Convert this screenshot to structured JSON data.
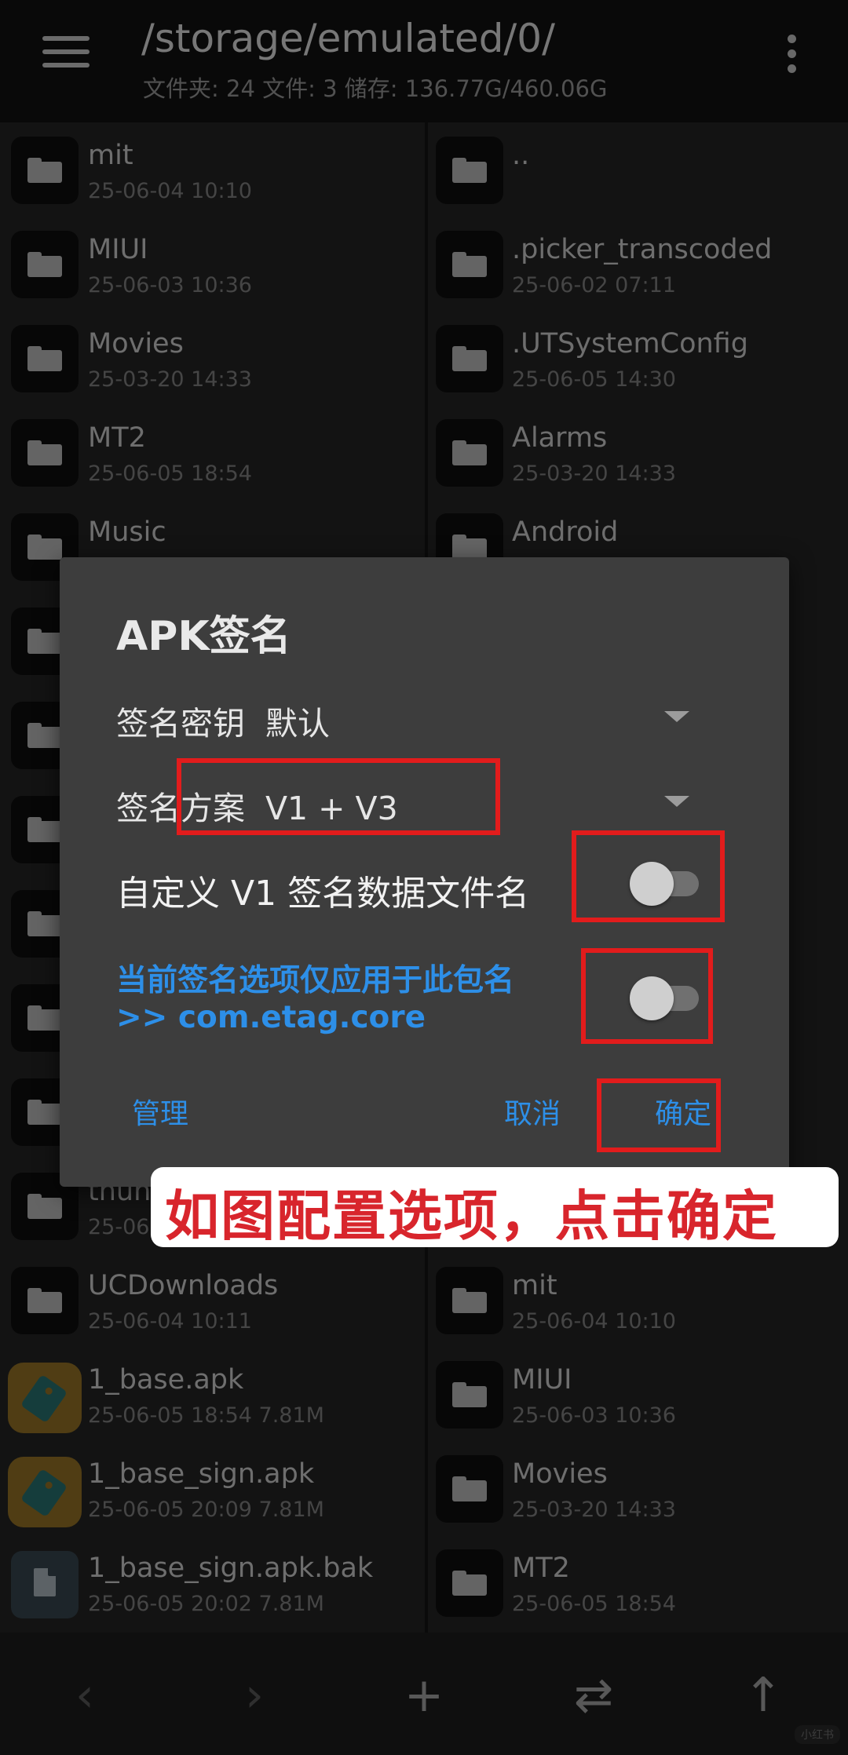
{
  "header": {
    "path": "/storage/emulated/0/",
    "summary": "文件夹: 24  文件: 3  储存: 136.77G/460.06G"
  },
  "left_pane": [
    {
      "name": "mit",
      "meta": "25-06-04 10:10",
      "icon": "folder-icon"
    },
    {
      "name": "MIUI",
      "meta": "25-06-03 10:36",
      "icon": "folder-icon"
    },
    {
      "name": "Movies",
      "meta": "25-03-20 14:33",
      "icon": "folder-icon"
    },
    {
      "name": "MT2",
      "meta": "25-06-05 18:54",
      "icon": "folder-icon"
    },
    {
      "name": "Music",
      "meta": "",
      "icon": "folder-icon"
    },
    {
      "name": "thun",
      "meta": "25-06",
      "icon": "folder-icon"
    },
    {
      "name": "UCDownloads",
      "meta": "25-06-04 10:11",
      "icon": "folder-icon"
    },
    {
      "name": "1_base.apk",
      "meta": "25-06-05 18:54  7.81M",
      "icon": "apk-icon"
    },
    {
      "name": "1_base_sign.apk",
      "meta": "25-06-05 20:09  7.81M",
      "icon": "apk-icon"
    },
    {
      "name": "1_base_sign.apk.bak",
      "meta": "25-06-05 20:02  7.81M",
      "icon": "file-icon"
    }
  ],
  "right_pane": [
    {
      "name": "..",
      "meta": "",
      "icon": "folder-icon"
    },
    {
      "name": ".picker_transcoded",
      "meta": "25-06-02 07:11",
      "icon": "folder-icon"
    },
    {
      "name": ".UTSystemConfig",
      "meta": "25-06-05 14:30",
      "icon": "folder-icon"
    },
    {
      "name": "Alarms",
      "meta": "25-03-20 14:33",
      "icon": "folder-icon"
    },
    {
      "name": "Android",
      "meta": "",
      "icon": "folder-icon"
    },
    {
      "name": "mit",
      "meta": "25-06-04 10:10",
      "icon": "folder-icon"
    },
    {
      "name": "MIUI",
      "meta": "25-06-03 10:36",
      "icon": "folder-icon"
    },
    {
      "name": "Movies",
      "meta": "25-03-20 14:33",
      "icon": "folder-icon"
    },
    {
      "name": "MT2",
      "meta": "25-06-05 18:54",
      "icon": "folder-icon"
    }
  ],
  "toolbar": {
    "back": "‹",
    "forward": "›",
    "add": "+",
    "swap": "⇄",
    "up": "↑"
  },
  "dialog": {
    "title": "APK签名",
    "key_label": "签名密钥",
    "key_value": "默认",
    "scheme_label": "签名方案",
    "scheme_value": "V1 + V3",
    "custom_v1_label": "自定义 V1 签名数据文件名",
    "custom_v1_enabled": false,
    "package_only_line1": "当前签名选项仅应用于此包名",
    "package_only_line2": ">> com.etag.core",
    "package_only_enabled": false,
    "manage_label": "管理",
    "cancel_label": "取消",
    "ok_label": "确定"
  },
  "annotation": {
    "callout": "如图配置选项，点击确定",
    "highlight_color": "#e21c1c"
  },
  "watermark": "小红书"
}
